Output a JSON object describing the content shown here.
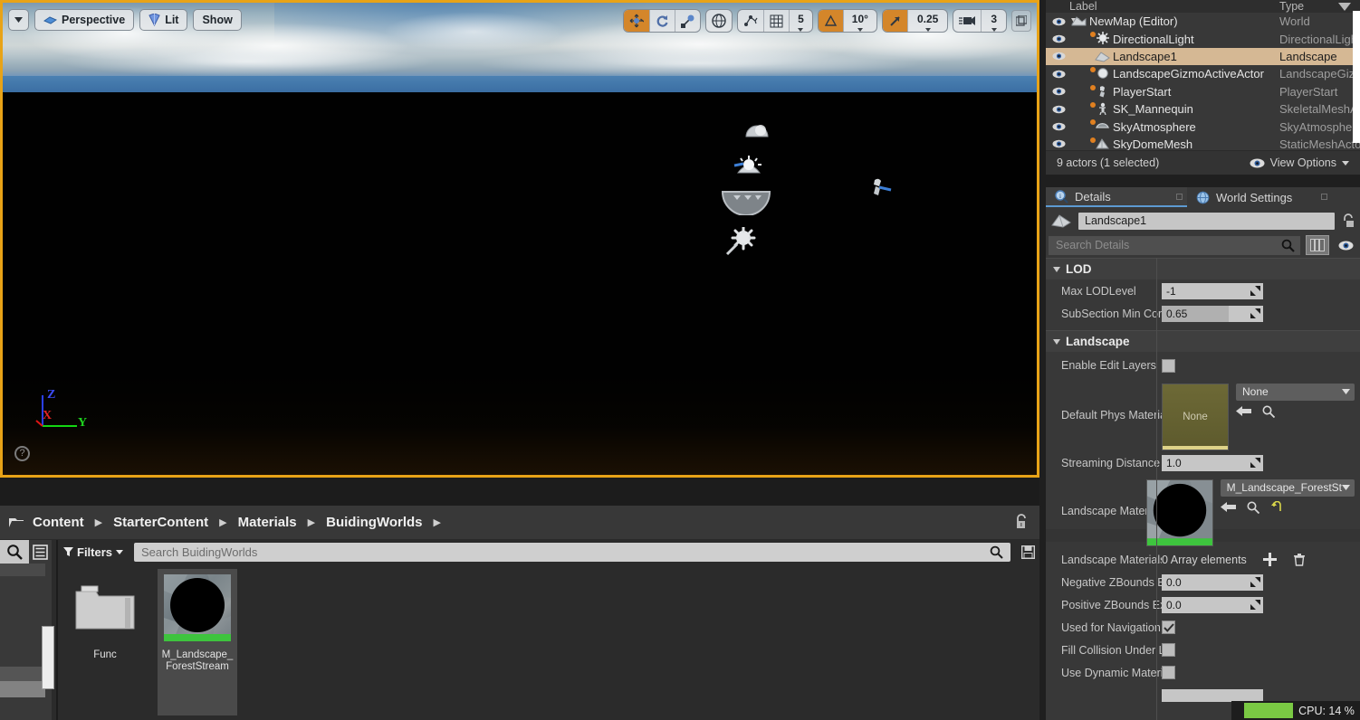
{
  "viewport": {
    "toolbar_left": [
      {
        "name": "viewport-options-dropdown",
        "label": "",
        "icon": "chevron-down-icon"
      },
      {
        "name": "perspective-button",
        "label": "Perspective",
        "icon": "camera-icon"
      },
      {
        "name": "lit-button",
        "label": "Lit",
        "icon": "lightbulb-icon"
      },
      {
        "name": "show-button",
        "label": "Show",
        "icon": ""
      }
    ],
    "toolbar_right": {
      "transform_group": [
        "select-move-icon",
        "rotate-icon",
        "scale-icon"
      ],
      "coordinate_system": "world-globe-icon",
      "surface_snap": "surface-snap-icon",
      "grid_snap_icon": "grid-icon",
      "grid_snap_value": "5",
      "angle_snap_icon": "angle-icon",
      "angle_snap_value": "10°",
      "scale_snap_icon": "scale-arrow-icon",
      "scale_snap_value": "0.25",
      "camera_speed_icon": "camera-speed-icon",
      "camera_speed_value": "3",
      "maximize_icon": "maximize-icon"
    },
    "axis_gizmo": {
      "x": "X",
      "y": "Y",
      "z": "Z"
    },
    "help_icon": "question-mark-icon",
    "actor_icons": [
      "skydome-icon",
      "directional-light-icon",
      "sky-atmosphere-icon",
      "landscape-gizmo-icon",
      "player-start-icon"
    ]
  },
  "content_browser": {
    "breadcrumb": [
      "Content",
      "StarterContent",
      "Materials",
      "BuidingWorlds"
    ],
    "lock_icon": "unlock-icon",
    "sources_icon": "search-icon",
    "list_icon": "list-view-icon",
    "filters_label": "Filters",
    "filters_icon": "funnel-icon",
    "search_placeholder": "Search BuidingWorlds",
    "save_icon": "save-icon",
    "items": [
      {
        "name": "Func",
        "type": "folder"
      },
      {
        "name": "M_Landscape_\nForestStream",
        "type": "material",
        "selected": true
      }
    ]
  },
  "outliner": {
    "columns": {
      "label": "Label",
      "type": "Type"
    },
    "sort_icon": "sort-descending-icon",
    "rows": [
      {
        "label": "NewMap (Editor)",
        "type": "World",
        "depth": 0,
        "icon": "world-icon",
        "expander": true,
        "selected": false
      },
      {
        "label": "DirectionalLight",
        "type": "DirectionalLight",
        "depth": 1,
        "icon": "light-icon",
        "selected": false
      },
      {
        "label": "Landscape1",
        "type": "Landscape",
        "depth": 1,
        "icon": "landscape-icon",
        "selected": true
      },
      {
        "label": "LandscapeGizmoActiveActor",
        "type": "LandscapeGizn",
        "depth": 1,
        "icon": "sphere-icon",
        "selected": false
      },
      {
        "label": "PlayerStart",
        "type": "PlayerStart",
        "depth": 1,
        "icon": "player-start-icon",
        "selected": false
      },
      {
        "label": "SK_Mannequin",
        "type": "SkeletalMeshAc",
        "depth": 1,
        "icon": "skeletal-mesh-icon",
        "selected": false
      },
      {
        "label": "SkyAtmosphere",
        "type": "SkyAtmosphere",
        "depth": 1,
        "icon": "sky-icon",
        "selected": false
      },
      {
        "label": "SkyDomeMesh",
        "type": "StaticMeshActo",
        "depth": 1,
        "icon": "static-mesh-icon",
        "selected": false
      }
    ],
    "status": "9 actors (1 selected)",
    "view_options": "View Options",
    "view_options_icon": "eye-icon"
  },
  "details": {
    "tabs": [
      {
        "label": "Details",
        "icon": "magnifier-info-icon",
        "active": true
      },
      {
        "label": "World Settings",
        "icon": "globe-icon",
        "active": false
      }
    ],
    "actor_icon": "landscape-icon",
    "actor_name": "Landscape1",
    "lock_icon": "unlock-icon",
    "search_placeholder": "Search Details",
    "search_icon": "magnifier-icon",
    "grid_icon": "column-view-icon",
    "eye_icon": "eye-icon",
    "sections": [
      {
        "title": "LOD",
        "rows": [
          {
            "name": "Max LODLevel",
            "kind": "number",
            "value": "-1"
          },
          {
            "name": "SubSection Min Com",
            "kind": "slider",
            "value": "0.65"
          }
        ]
      },
      {
        "title": "Landscape",
        "rows": [
          {
            "name": "Enable Edit Layers",
            "kind": "checkbox",
            "checked": false
          },
          {
            "name": "Default Phys Materia",
            "kind": "asset",
            "thumb_label": "None",
            "dropdown": "None",
            "thumb_color": "#6a6632"
          },
          {
            "name": "Streaming Distance",
            "kind": "number",
            "value": "1.0"
          },
          {
            "name": "Landscape Material",
            "kind": "asset",
            "thumb_label": "",
            "dropdown": "M_Landscape_ForestSt",
            "thumb_color": "#000000"
          },
          {
            "name": "Landscape Materials",
            "kind": "array",
            "value": "0 Array elements"
          },
          {
            "name": "Negative ZBounds E",
            "kind": "number",
            "value": "0.0"
          },
          {
            "name": "Positive ZBounds Ex",
            "kind": "number",
            "value": "0.0"
          },
          {
            "name": "Used for Navigation",
            "kind": "checkbox",
            "checked": true
          },
          {
            "name": "Fill Collision Under L",
            "kind": "checkbox",
            "checked": false
          },
          {
            "name": "Use Dynamic Materi",
            "kind": "checkbox",
            "checked": false
          }
        ]
      }
    ],
    "add_icon": "plus-icon",
    "delete_icon": "trash-icon",
    "reset_icon": "reset-arrow-icon",
    "browse_icon": "magnifier-icon",
    "use_selected_icon": "left-arrow-icon"
  },
  "status_bar": {
    "cpu_label": "CPU: 14 %",
    "cpu_percent": 14,
    "cpu_color": "#7ac943"
  }
}
